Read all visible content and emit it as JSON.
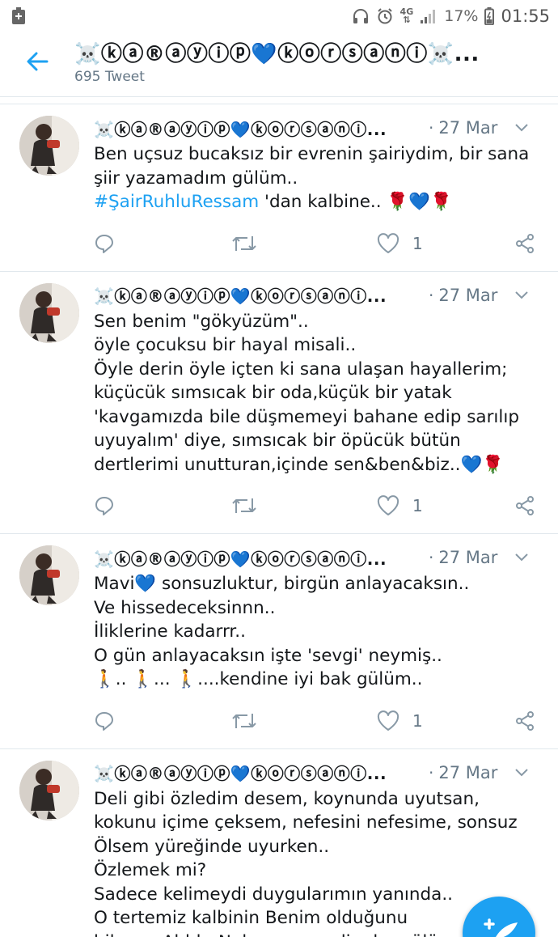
{
  "status_bar": {
    "battery": "17%",
    "time": "01:55",
    "network": "4G"
  },
  "header": {
    "title": "☠️ⓚⓐ®ⓐⓨⓘⓟ💙ⓚⓞⓡⓢⓐⓝⓘ☠️...",
    "tweet_count": "695 Tweet"
  },
  "tweets": [
    {
      "name": "☠️ⓚⓐ®ⓐⓨⓘⓟ💙ⓚⓞⓡⓢⓐⓝⓘ...",
      "date": "27 Mar",
      "text_before": "Ben uçsuz bucaksız bir evrenin şairiydim,  bir sana şiir yazamadım gülüm..\n",
      "hashtag": "#ŞairRuhluRessam",
      "text_after": " 'dan kalbine.. 🌹💙🌹",
      "likes": "1"
    },
    {
      "name": "☠️ⓚⓐ®ⓐⓨⓘⓟ💙ⓚⓞⓡⓢⓐⓝⓘ...",
      "date": "27 Mar",
      "text": "Sen benim \"gökyüzüm\"..\nöyle çocuksu bir hayal misali..\nÖyle derin öyle içten ki sana ulaşan hayallerim; küçücük sımsıcak bir oda,küçük bir yatak 'kavgamızda bile düşmemeyi bahane edip sarılıp uyuyalım' diye, sımsıcak bir öpücük bütün dertlerimi unutturan,içinde sen&ben&biz..💙🌹",
      "likes": "1"
    },
    {
      "name": "☠️ⓚⓐ®ⓐⓨⓘⓟ💙ⓚⓞⓡⓢⓐⓝⓘ...",
      "date": "27 Mar",
      "text": "Mavi💙 sonsuzluktur, birgün anlayacaksın..\nVe hissedeceksinnn..\nİliklerine kadarrr..\nO gün anlayacaksın işte 'sevgi' neymiş..\n🚶.. 🚶... 🚶....kendine iyi bak gülüm..",
      "likes": "1"
    },
    {
      "name": "☠️ⓚⓐ®ⓐⓨⓘⓟ💙ⓚⓞⓡⓢⓐⓝⓘ...",
      "date": "27 Mar",
      "text": "Deli gibi özledim desem, koynunda uyutsan, kokunu içime çeksem, nefesini nefesime, sonsuz Ölsem yüreğinde uyurken..\nÖzlemek mi?\nSadece kelimeydi duygularımın yanında..\nO tertemiz kalbinin Benim olduğunu bilsem..Ahhh..Neler vermezdim be gülüm..\n...kaptan jack sparrow.. 💙👱🙈🌹",
      "likes": ""
    }
  ],
  "icons": {
    "back": "arrow-left-icon",
    "reply": "reply-icon",
    "retweet": "retweet-icon",
    "like": "heart-icon",
    "share": "share-icon",
    "caret": "chevron-down-icon",
    "compose": "compose-icon"
  },
  "colors": {
    "accent": "#1da1f2",
    "secondary_text": "#657786",
    "divider": "#e1e8ed"
  }
}
